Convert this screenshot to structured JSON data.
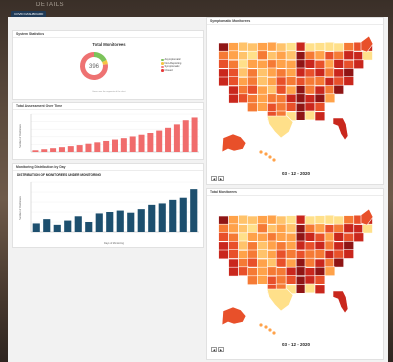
{
  "background": {
    "text": "DETAILS"
  },
  "top_button": {
    "label": "COVID DASHBOARD"
  },
  "system_stats": {
    "title": "System Statistics",
    "donut": {
      "title": "Total Monitorees",
      "center_value": "396",
      "caption": "Hover over the segments of the chart",
      "legend": [
        {
          "label": "Asymptomatic",
          "color": "#7cc35a"
        },
        {
          "label": "Non-Reporting",
          "color": "#f5c542"
        },
        {
          "label": "Symptomatic",
          "color": "#f08080"
        },
        {
          "label": "Closed",
          "color": "#e83a3a"
        }
      ],
      "segments": [
        {
          "label": "Asymptomatic",
          "value": 0.18,
          "color": "#7cc35a"
        },
        {
          "label": "Non-Reporting",
          "value": 0.05,
          "color": "#f5c542"
        },
        {
          "label": "Symptomatic",
          "value": 0.77,
          "color": "#ee7272"
        }
      ]
    }
  },
  "assessments": {
    "title": "Total Assessment Over Time",
    "ylabel": "Number of Monitorees"
  },
  "distribution": {
    "title": "Monitoring Distribution by Day",
    "subtitle": "DISTRIBUTION OF MONITOREES UNDER MONITORING",
    "ylabel": "Number of Monitorees",
    "xlabel": "Days of Monitoring"
  },
  "symptomatic_map": {
    "title": "Symptomatic Monitorees",
    "date": "03 - 12 - 2020"
  },
  "total_map": {
    "title": "Total Monitorees",
    "date": "03 - 12 - 2020"
  },
  "map_controls": {
    "prev": "◀",
    "next": "▶"
  },
  "chart_data": [
    {
      "type": "bar",
      "title": "Total Assessment Over Time",
      "ylabel": "Number of Monitorees",
      "color": "#f06c6c",
      "values": [
        5,
        8,
        11,
        14,
        17,
        20,
        24,
        28,
        32,
        36,
        40,
        45,
        50,
        55,
        62,
        70,
        80,
        92,
        100
      ],
      "ylim": [
        0,
        110
      ],
      "grid": true
    },
    {
      "type": "bar",
      "title": "Monitoring Distribution by Day",
      "subtitle": "DISTRIBUTION OF MONITOREES UNDER MONITORING",
      "xlabel": "Days of Monitoring",
      "ylabel": "Number of Monitorees",
      "color": "#1d4f6e",
      "values": [
        12,
        18,
        10,
        16,
        22,
        14,
        26,
        28,
        30,
        27,
        32,
        38,
        40,
        45,
        48,
        60
      ],
      "ylim": [
        0,
        70
      ],
      "grid": true
    }
  ]
}
